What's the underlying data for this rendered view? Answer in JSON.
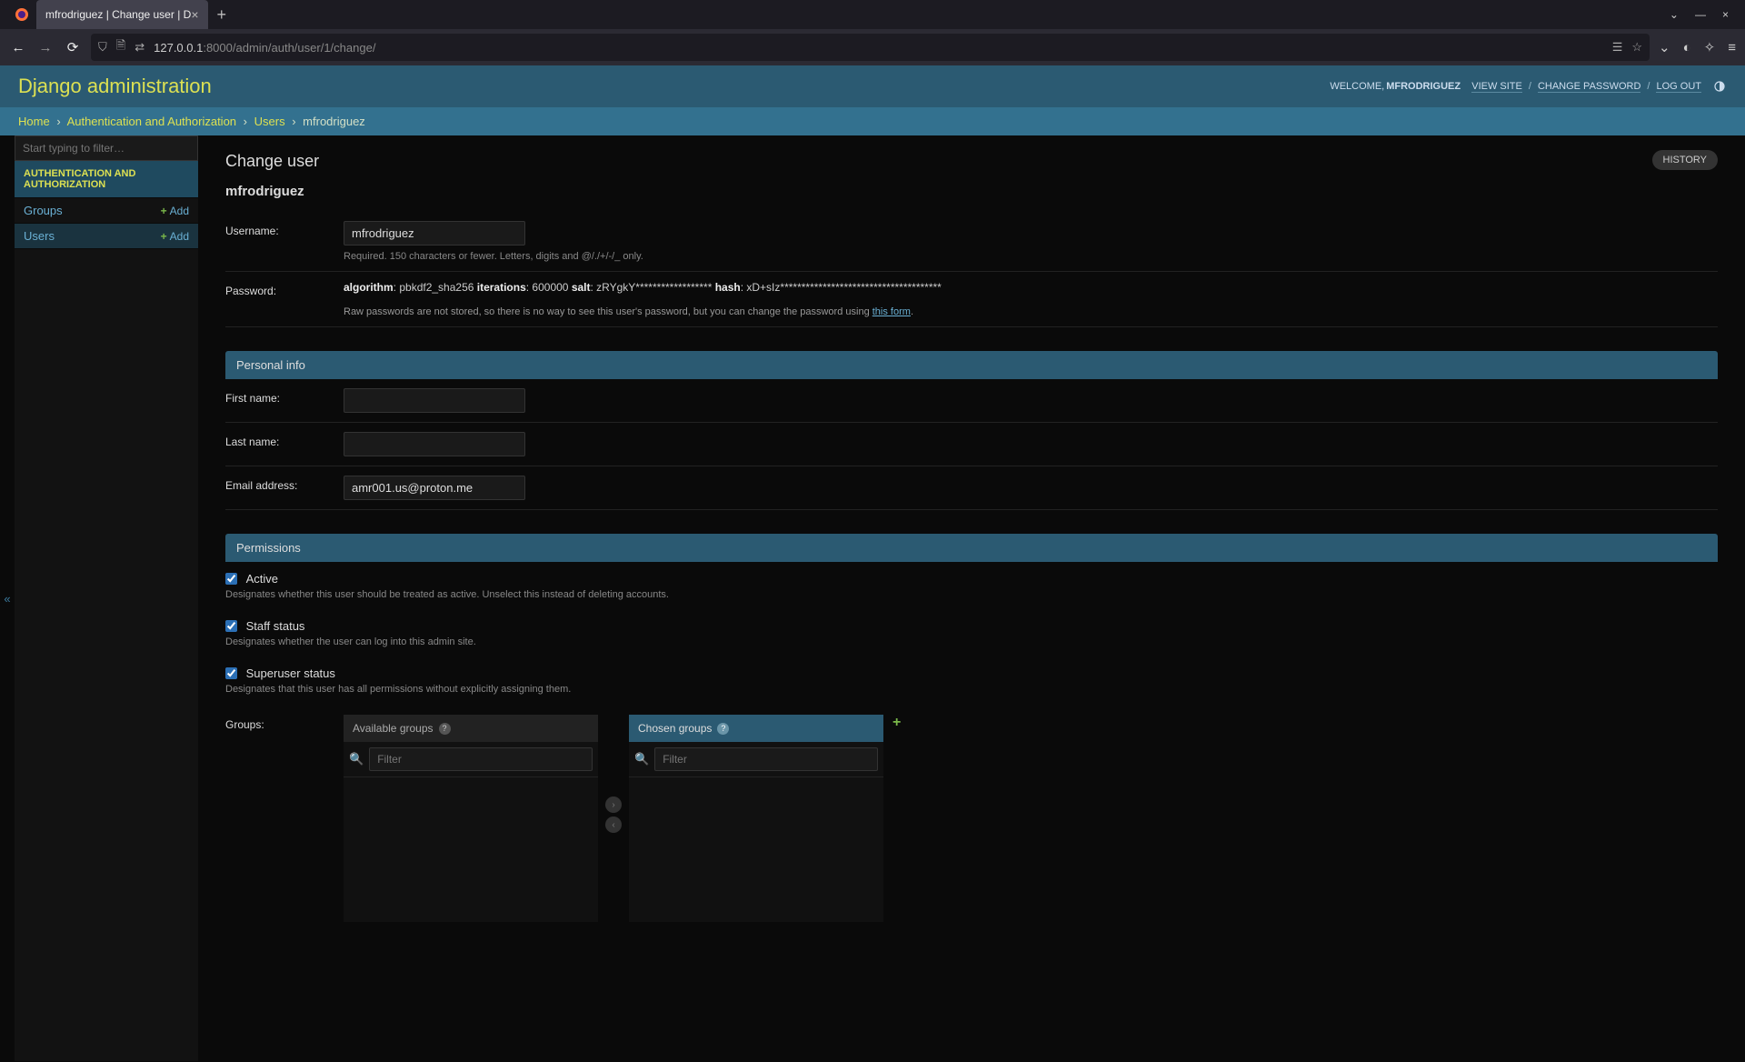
{
  "browser": {
    "tab_title": "mfrodriguez | Change user | D",
    "url_host": "127.0.0.1",
    "url_rest": ":8000/admin/auth/user/1/change/"
  },
  "header": {
    "site_title": "Django administration",
    "welcome": "WELCOME, ",
    "username": "MFRODRIGUEZ",
    "view_site": "VIEW SITE",
    "change_password": "CHANGE PASSWORD",
    "logout": "LOG OUT"
  },
  "breadcrumbs": {
    "home": "Home",
    "app": "Authentication and Authorization",
    "model": "Users",
    "obj": "mfrodriguez"
  },
  "sidebar": {
    "filter_placeholder": "Start typing to filter…",
    "app_label": "AUTHENTICATION AND AUTHORIZATION",
    "groups": "Groups",
    "users": "Users",
    "add": "Add"
  },
  "page": {
    "title": "Change user",
    "history": "HISTORY",
    "object": "mfrodriguez"
  },
  "fields": {
    "username_label": "Username:",
    "username_value": "mfrodriguez",
    "username_help": "Required. 150 characters or fewer. Letters, digits and @/./+/-/_ only.",
    "password_label": "Password:",
    "pw_algorithm_k": "algorithm",
    "pw_algorithm_v": ": pbkdf2_sha256 ",
    "pw_iter_k": "iterations",
    "pw_iter_v": ": 600000 ",
    "pw_salt_k": "salt",
    "pw_salt_v": ": zRYgkY****************** ",
    "pw_hash_k": "hash",
    "pw_hash_v": ": xD+sIz************************************** ",
    "pw_note_pre": "Raw passwords are not stored, so there is no way to see this user's password, but you can change the password using ",
    "pw_note_link": "this form",
    "pw_note_post": "."
  },
  "personal": {
    "section": "Personal info",
    "first_label": "First name:",
    "first_value": "",
    "last_label": "Last name:",
    "last_value": "",
    "email_label": "Email address:",
    "email_value": "amr001.us@proton.me"
  },
  "permissions": {
    "section": "Permissions",
    "active_label": "Active",
    "active_help": "Designates whether this user should be treated as active. Unselect this instead of deleting accounts.",
    "staff_label": "Staff status",
    "staff_help": "Designates whether the user can log into this admin site.",
    "super_label": "Superuser status",
    "super_help": "Designates that this user has all permissions without explicitly assigning them.",
    "groups_label": "Groups:",
    "available": "Available groups",
    "chosen": "Chosen groups",
    "filter_placeholder": "Filter"
  }
}
